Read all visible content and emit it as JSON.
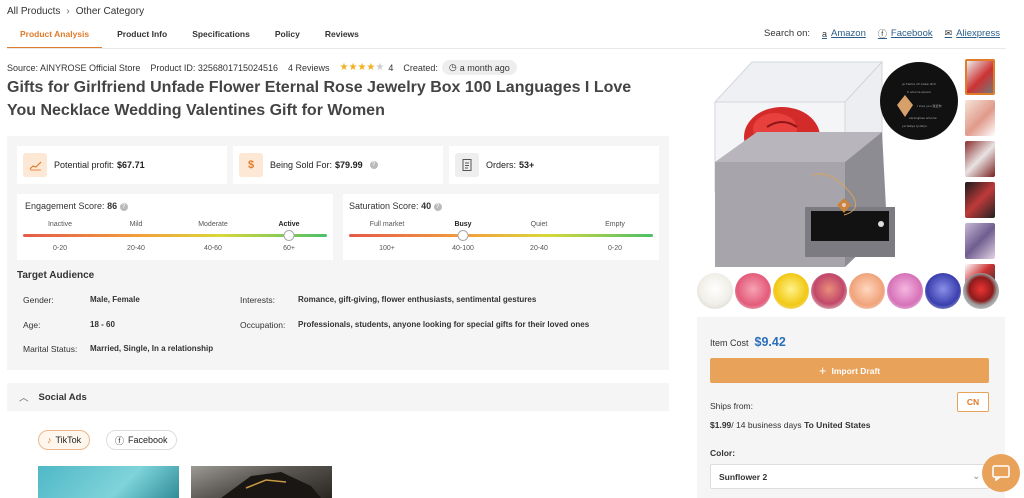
{
  "breadcrumb": {
    "items": [
      "All Products",
      "Other Category"
    ]
  },
  "tabs": [
    {
      "label": "Product Analysis",
      "active": true
    },
    {
      "label": "Product Info"
    },
    {
      "label": "Specifications"
    },
    {
      "label": "Policy"
    },
    {
      "label": "Reviews"
    }
  ],
  "search_on": {
    "label": "Search on:",
    "links": [
      {
        "label": "Amazon",
        "icon": "amazon-icon"
      },
      {
        "label": "Facebook",
        "icon": "facebook-icon"
      },
      {
        "label": "Aliexpress",
        "icon": "mail-icon"
      }
    ]
  },
  "meta": {
    "source": "Source: AINYROSE Official Store",
    "product_id": "Product ID: 3256801715024516",
    "reviews": "4 Reviews",
    "rating": "4",
    "rating_value": 4,
    "created_label": "Created:",
    "created_value": "a month ago"
  },
  "title": "Gifts for Girlfriend Unfade Flower Eternal Rose Jewelry Box 100 Languages I Love You Necklace Wedding Valentines Gift for Women",
  "stats": {
    "profit_label": "Potential profit:",
    "profit_value": "$67.71",
    "sold_label": "Being Sold For:",
    "sold_value": "$79.99",
    "orders_label": "Orders:",
    "orders_value": "53+"
  },
  "engagement": {
    "title": "Engagement Score:",
    "score": "86",
    "levels": [
      "Inactive",
      "Mild",
      "Moderate",
      "Active"
    ],
    "ranges": [
      "0-20",
      "20-40",
      "40-60",
      "60+"
    ],
    "active_index": 3
  },
  "saturation": {
    "title": "Saturation Score:",
    "score": "40",
    "levels": [
      "Full market",
      "Busy",
      "Quiet",
      "Empty"
    ],
    "ranges": [
      "100+",
      "40-100",
      "20-40",
      "0-20"
    ],
    "active_index": 1
  },
  "audience": {
    "title": "Target Audience",
    "gender_label": "Gender:",
    "gender": "Male, Female",
    "age_label": "Age:",
    "age": "18 - 60",
    "marital_label": "Marital Status:",
    "marital": "Married, Single, In a relationship",
    "interests_label": "Interests:",
    "interests": "Romance, gift-giving, flower enthusiasts, sentimental gestures",
    "occupation_label": "Occupation:",
    "occupation": "Professionals, students, anyone looking for special gifts for their loved ones"
  },
  "social": {
    "title": "Social Ads",
    "chips": [
      {
        "label": "TikTok",
        "active": true
      },
      {
        "label": "Facebook"
      }
    ]
  },
  "purchase": {
    "cost_label": "Item Cost",
    "cost": "$9.42",
    "import_label": "Import Draft",
    "ships_label": "Ships from:",
    "ships_from": "CN",
    "shipping_price": "$1.99",
    "shipping_days": "/ 14 business days",
    "shipping_dest": "To United States",
    "color_label": "Color:",
    "color_value": "Sunflower 2"
  },
  "colors": {
    "accent": "#e07b2b",
    "button": "#e9a25a",
    "price": "#2a6fb8",
    "panel_bg": "#f5f5f5"
  }
}
